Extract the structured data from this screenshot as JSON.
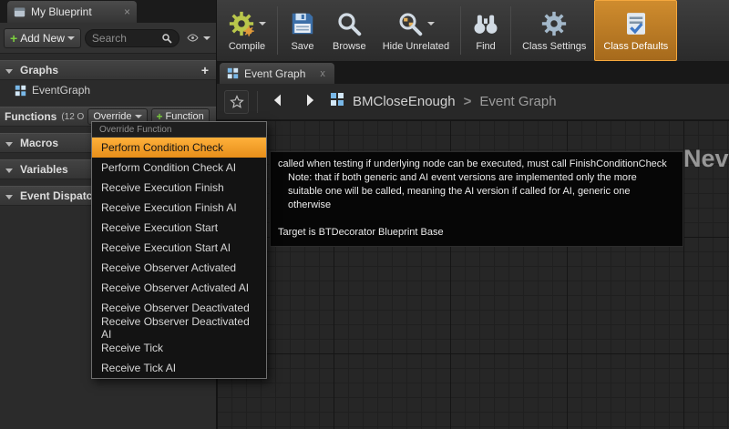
{
  "icons": {
    "plus": "+",
    "close": "×",
    "tab_close": "x",
    "breadcrumb_separator": ">"
  },
  "colors": {
    "accent_orange": "#E8921A",
    "add_green": "#7CCF3F",
    "canvas_bg": "#262626"
  },
  "sidebar": {
    "tab": {
      "title": "My Blueprint"
    },
    "add_new": {
      "label": "Add New"
    },
    "search": {
      "placeholder": "Search"
    },
    "graphs": {
      "label": "Graphs"
    },
    "event_graph": {
      "label": "EventGraph"
    },
    "functions": {
      "label": "Functions",
      "count": "(12 O",
      "override": "Override",
      "add_function": "Function"
    },
    "macros": {
      "label": "Macros"
    },
    "variables": {
      "label": "Variables"
    },
    "event_dispatchers": {
      "label": "Event Dispatch..."
    }
  },
  "override_menu": {
    "header": "Override Function",
    "items": [
      "Perform Condition Check",
      "Perform Condition Check AI",
      "Receive Execution Finish",
      "Receive Execution Finish AI",
      "Receive Execution Start",
      "Receive Execution Start AI",
      "Receive Observer Activated",
      "Receive Observer Activated AI",
      "Receive Observer Deactivated",
      "Receive Observer Deactivated AI",
      "Receive Tick",
      "Receive Tick AI"
    ],
    "highlighted_item": "Perform Condition Check"
  },
  "toolbar": {
    "compile": "Compile",
    "save": "Save",
    "browse": "Browse",
    "hide_unrelated": "Hide Unrelated",
    "find": "Find",
    "class_settings": "Class Settings",
    "class_defaults": "Class Defaults",
    "active_button": "Class Defaults"
  },
  "graph_tab": {
    "label": "Event Graph"
  },
  "breadcrumb": {
    "root": "BMCloseEnough",
    "separator": ">",
    "current": "Event Graph"
  },
  "tooltip": {
    "line1": "called when testing if underlying node can be executed, must call FinishConditionCheck",
    "line2": "Note: that if both generic and AI event versions are implemented only the more",
    "line3": "suitable one will be called, meaning the AI version if called for AI, generic one otherwise",
    "target": "Target is BTDecorator Blueprint Base"
  },
  "canvas": {
    "watermark_partial": "Nev"
  }
}
